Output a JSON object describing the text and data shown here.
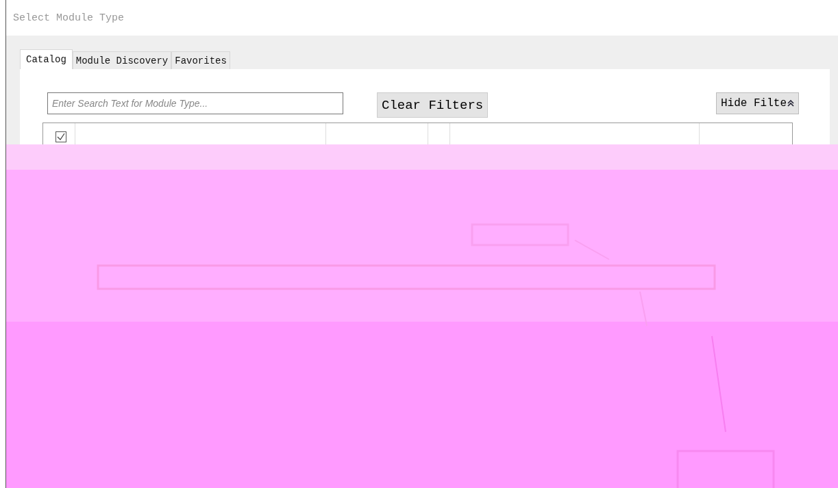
{
  "window": {
    "title": "Select Module Type"
  },
  "tabs": [
    {
      "label": "Catalog",
      "selected": true
    },
    {
      "label": "Module Discovery",
      "selected": false
    },
    {
      "label": "Favorites",
      "selected": false
    }
  ],
  "search": {
    "placeholder": "Enter Search Text for Module Type..."
  },
  "clear_filters_button": {
    "label": "Clear Filters"
  },
  "hide_filter_button": {
    "label": "Hide Filte"
  },
  "table": {
    "header_checkbox": {
      "checked": true
    }
  }
}
